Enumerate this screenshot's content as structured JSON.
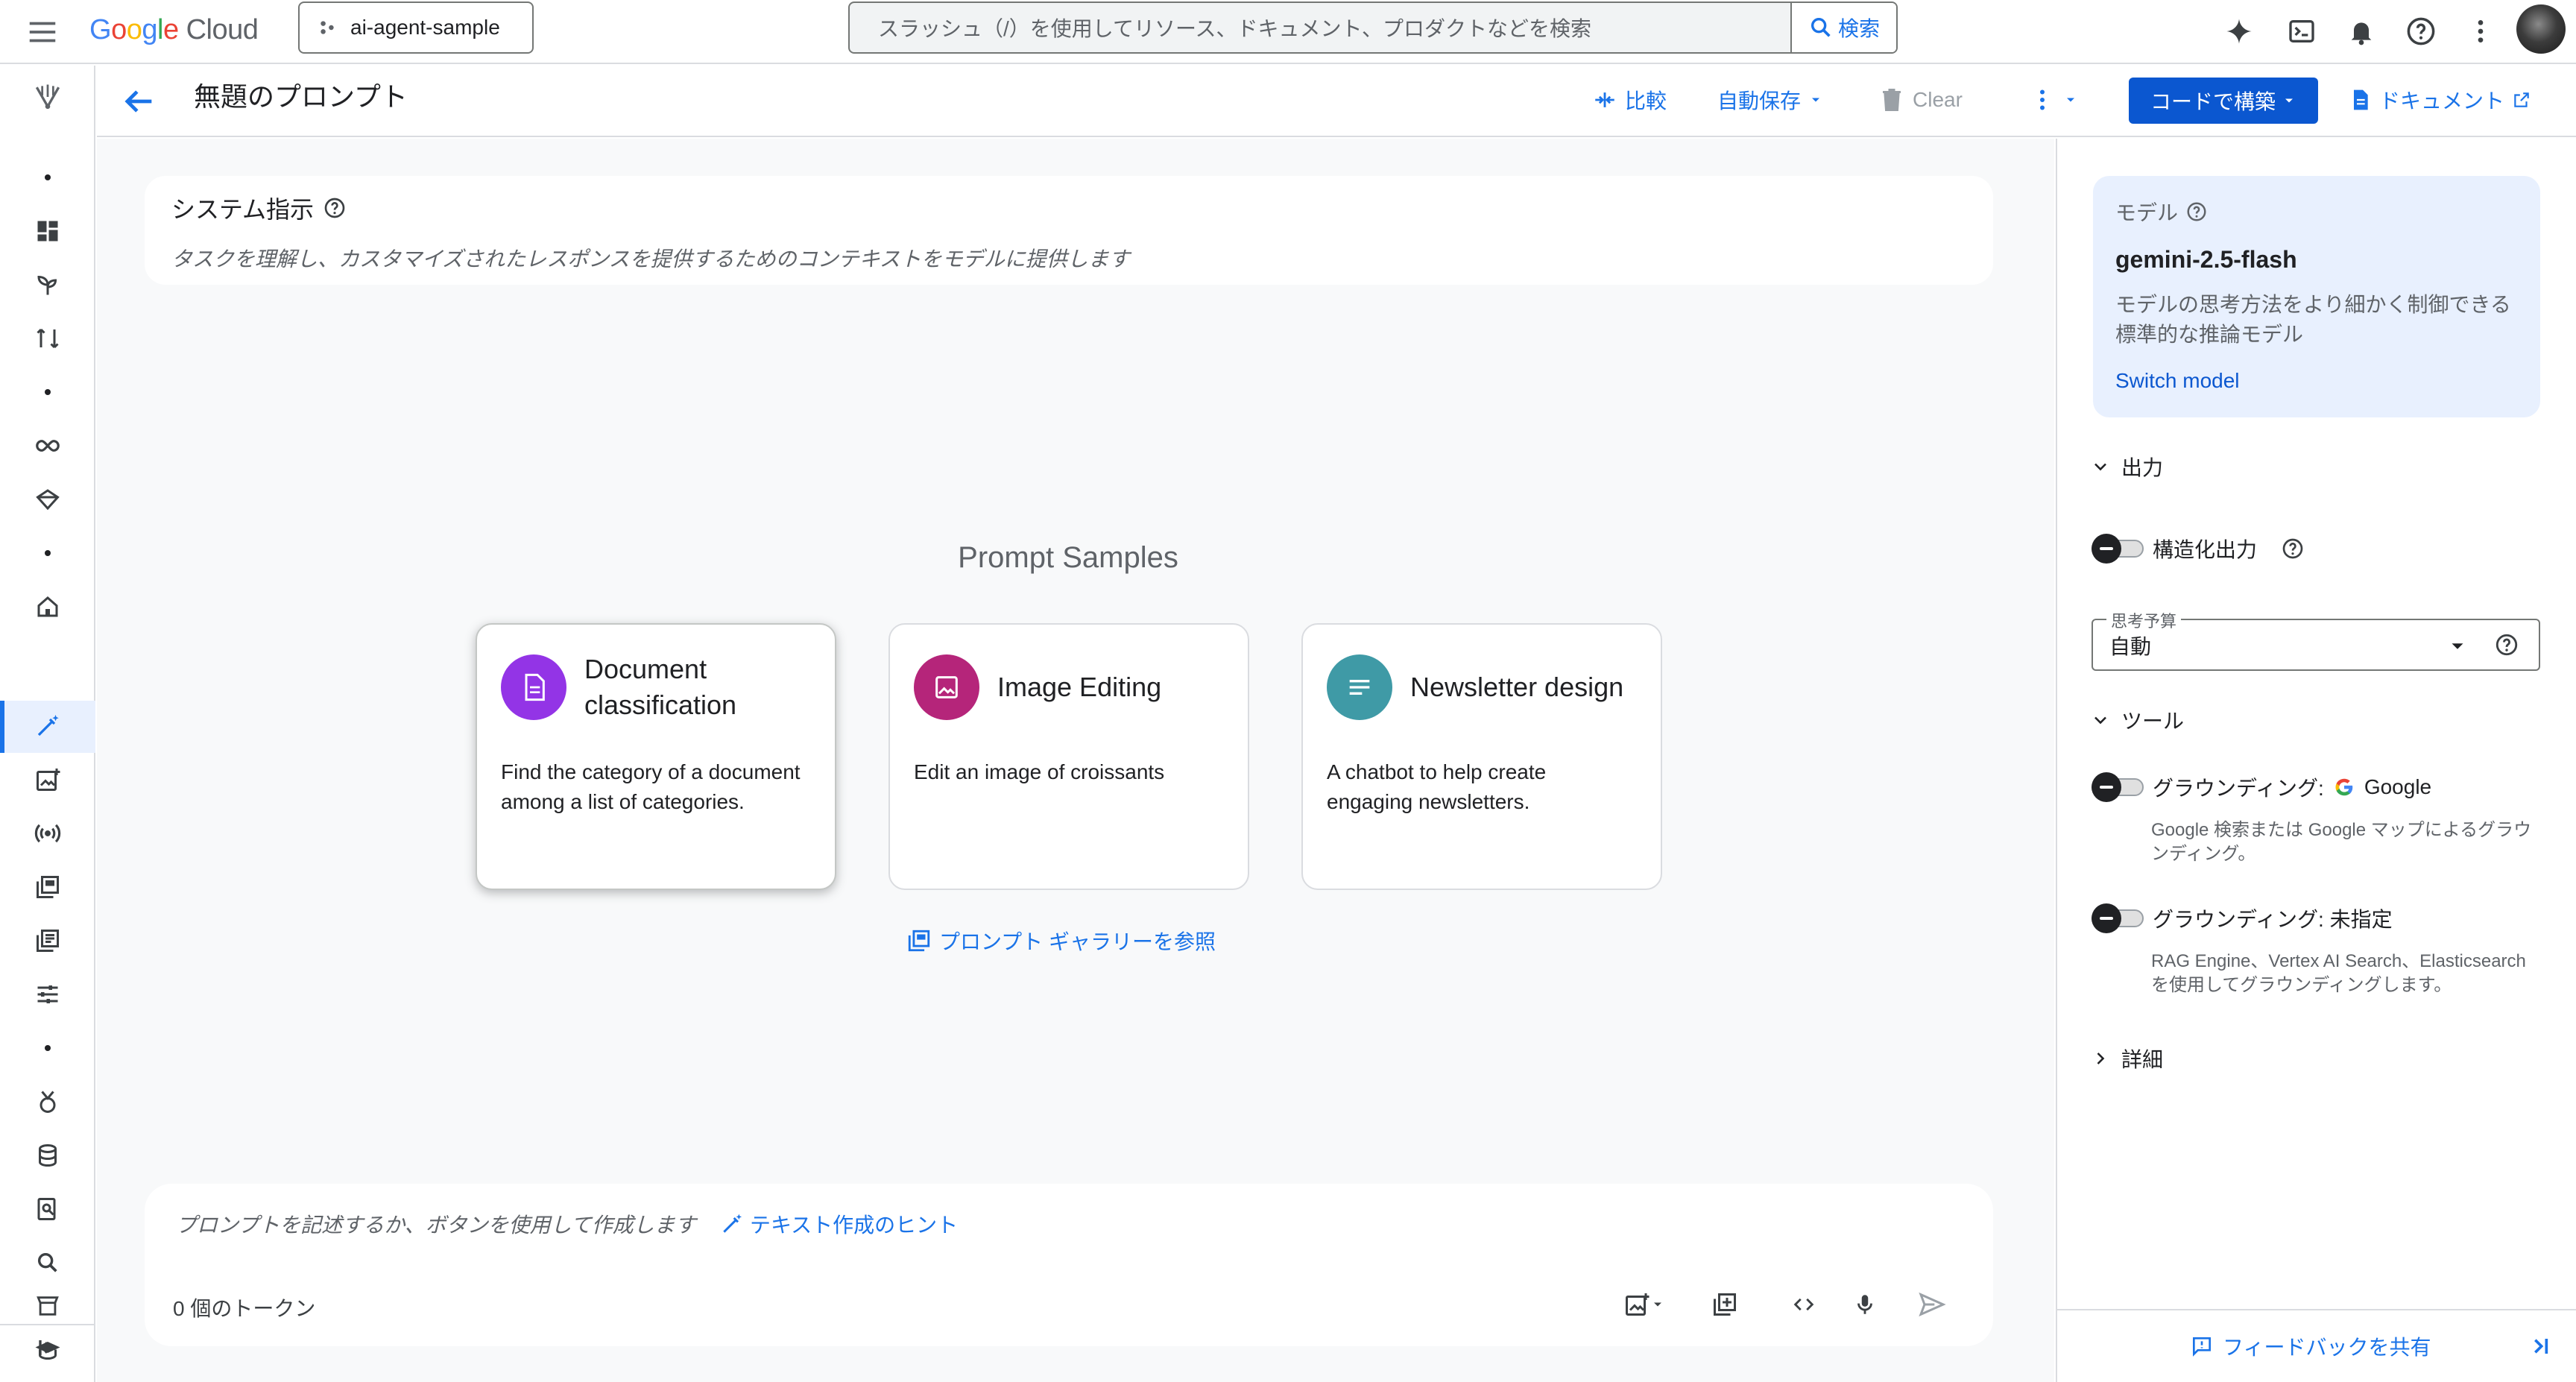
{
  "topbar": {
    "logo_google": [
      "G",
      "o",
      "o",
      "g",
      "l",
      "e"
    ],
    "logo_cloud": "Cloud",
    "project_name": "ai-agent-sample",
    "search_placeholder": "スラッシュ（/）を使用してリソース、ドキュメント、プロダクトなどを検索",
    "search_button": "検索"
  },
  "header": {
    "title": "無題のプロンプト",
    "compare_label": "比較",
    "autosave_label": "自動保存",
    "clear_label": "Clear",
    "build_label": "コードで構築",
    "docs_label": "ドキュメント"
  },
  "system_instructions": {
    "title": "システム指示",
    "placeholder": "タスクを理解し、カスタマイズされたレスポンスを提供するためのコンテキストをモデルに提供します"
  },
  "samples": {
    "title": "Prompt Samples",
    "cards": [
      {
        "title": "Document classification",
        "desc": "Find the category of a document among a list of categories.",
        "icon": "document-icon",
        "color": "#9334e6"
      },
      {
        "title": "Image Editing",
        "desc": "Edit an image of croissants",
        "icon": "image-icon",
        "color": "#b5257a"
      },
      {
        "title": "Newsletter design",
        "desc": "A chatbot to help create engaging newsletters.",
        "icon": "notes-icon",
        "color": "#3f9aa6"
      }
    ],
    "gallery_link": "プロンプト ギャラリーを参照"
  },
  "prompt": {
    "placeholder": "プロンプトを記述するか、ボタンを使用して作成します",
    "hint_label": "テキスト作成のヒント",
    "tokens": "0 個のトークン"
  },
  "right_panel": {
    "model_label": "モデル",
    "model_name": "gemini-2.5-flash",
    "model_desc": "モデルの思考方法をより細かく制御できる標準的な推論モデル",
    "switch_model": "Switch model",
    "output_section": "出力",
    "structured_output": "構造化出力",
    "thinking_budget_label": "思考予算",
    "thinking_budget_value": "自動",
    "tools_section": "ツール",
    "grounding_google_label": "グラウンディング:",
    "grounding_google_value": "Google",
    "grounding_google_desc": "Google 検索または Google マップによるグラウンディング。",
    "grounding_unspecified": "グラウンディング: 未指定",
    "grounding_unspecified_desc": "RAG Engine、Vertex AI Search、Elasticsearch を使用してグラウンディングします。",
    "advanced_section": "詳細",
    "feedback_label": "フィードバックを共有"
  },
  "colors": {
    "accent": "#1a73e8",
    "primary_button": "#0b57d0",
    "model_card_bg": "#e8f0fe"
  }
}
